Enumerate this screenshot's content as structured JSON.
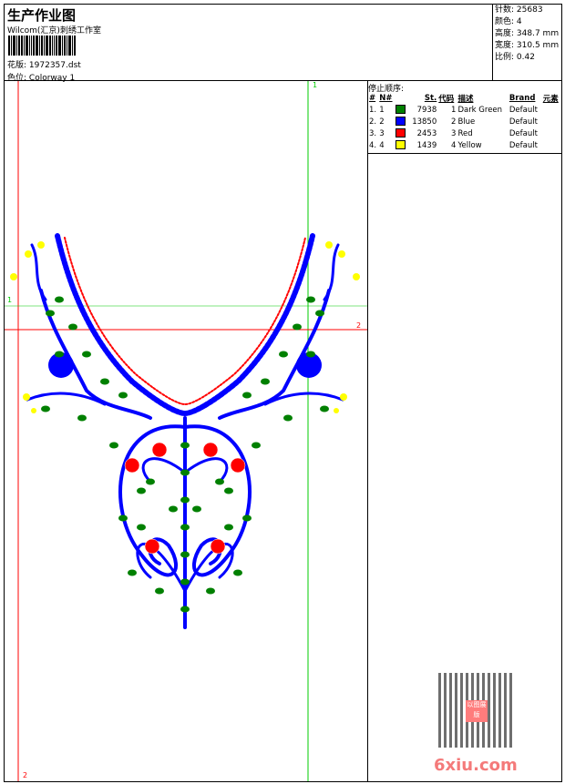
{
  "header": {
    "title": "生产作业图",
    "subtitle": "Wilcom(汇京)刺绣工作室",
    "design_label": "花版:",
    "design_value": "1972357.dst",
    "colorway_label": "色位:",
    "colorway_value": "Colorway 1"
  },
  "info": [
    {
      "label": "针数:",
      "value": "25683"
    },
    {
      "label": "颜色:",
      "value": "4"
    },
    {
      "label": "高度:",
      "value": "348.7 mm"
    },
    {
      "label": "宽度:",
      "value": "310.5 mm"
    },
    {
      "label": "比例:",
      "value": "0.42"
    }
  ],
  "stop_sequence": {
    "title": "停止顺序:",
    "columns": [
      "#",
      "N#",
      "St.",
      "代码",
      "描述",
      "Brand",
      "元素"
    ],
    "rows": [
      {
        "idx": "1.",
        "n": "1",
        "color": "#008000",
        "st": "7938",
        "code": "1",
        "desc": "Dark Green",
        "brand": "Default"
      },
      {
        "idx": "2.",
        "n": "2",
        "color": "#0000ff",
        "st": "13850",
        "code": "2",
        "desc": "Blue",
        "brand": "Default"
      },
      {
        "idx": "3.",
        "n": "3",
        "color": "#ff0000",
        "st": "2453",
        "code": "3",
        "desc": "Red",
        "brand": "Default"
      },
      {
        "idx": "4.",
        "n": "4",
        "color": "#ffff00",
        "st": "1439",
        "code": "4",
        "desc": "Yellow",
        "brand": "Default"
      }
    ]
  },
  "guides": {
    "v1": "1",
    "v2": "2",
    "h1": "1",
    "h2": "2"
  },
  "watermark": {
    "text": "6xiu.com",
    "seal": "以图展版"
  }
}
